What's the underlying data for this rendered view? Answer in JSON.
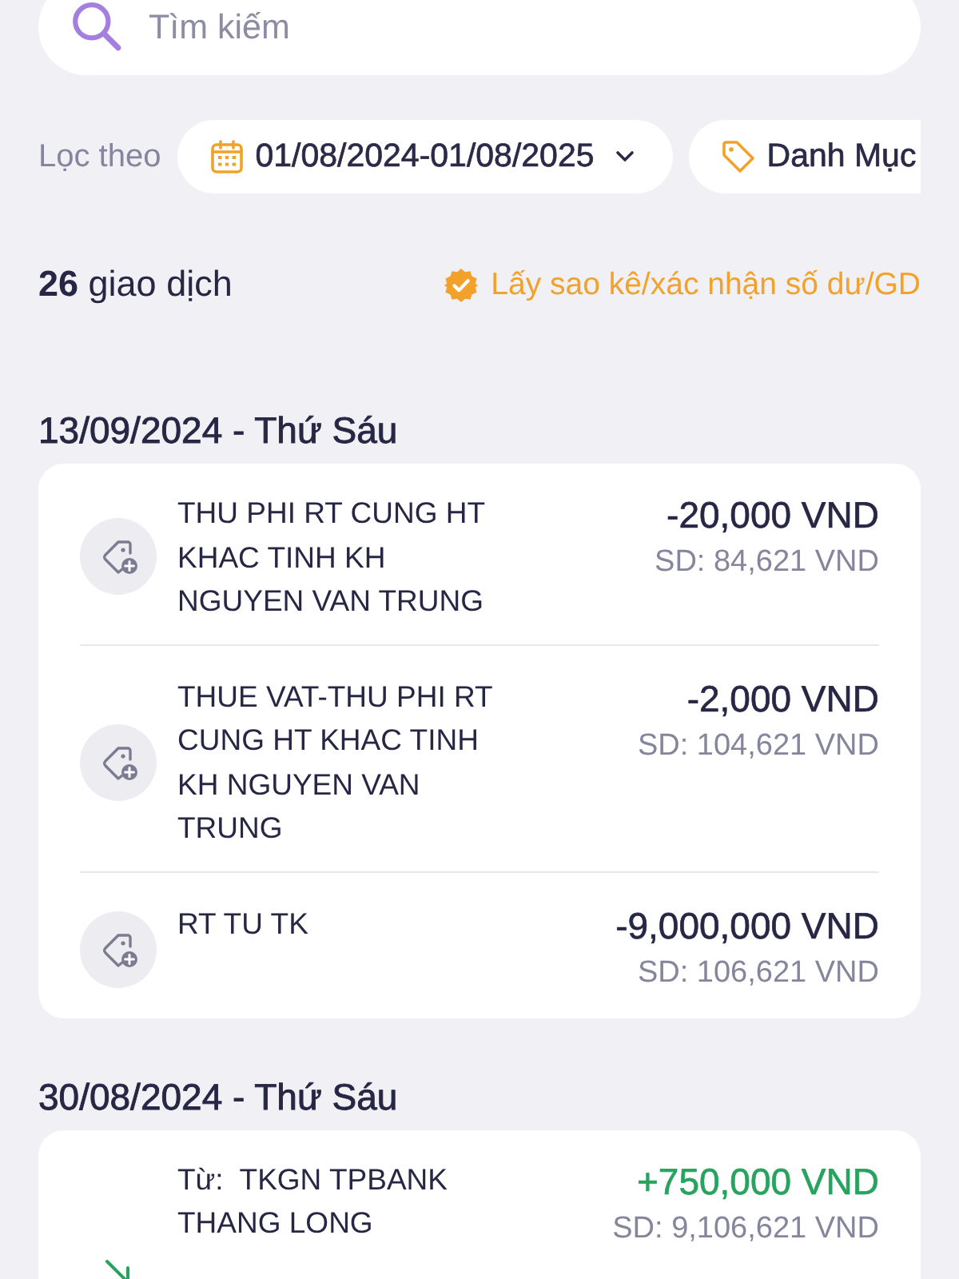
{
  "search": {
    "placeholder": "Tìm kiếm"
  },
  "filters": {
    "label": "Lọc theo",
    "chips": [
      {
        "kind": "date",
        "label": "01/08/2024-01/08/2025"
      },
      {
        "kind": "category",
        "label": "Danh Mục"
      }
    ]
  },
  "summary": {
    "count_text": "**26** giao dịch",
    "statement_link": "Lấy sao kê/xác nhận số dư/GD"
  },
  "groups": [
    {
      "date": "13/09/2024 - Thứ Sáu",
      "transactions": [
        {
          "kind": "debit",
          "description": "THU PHI RT CUNG HT KHAC TINH KH NGUYEN VAN TRUNG",
          "amount": "-20,000 VND",
          "balance": "SD: 84,621 VND"
        },
        {
          "kind": "debit",
          "description": "THUE VAT-THU PHI RT CUNG HT KHAC TINH KH NGUYEN VAN TRUNG",
          "amount": "-2,000 VND",
          "balance": "SD: 104,621 VND"
        },
        {
          "kind": "debit",
          "description": "RT TU TK",
          "amount": "-9,000,000 VND",
          "balance": "SD: 106,621 VND"
        }
      ]
    },
    {
      "date": "30/08/2024 - Thứ Sáu",
      "transactions": [
        {
          "kind": "credit",
          "description": "Từ:  TKGN TPBANK THANG LONG",
          "amount": "+750,000 VND",
          "balance": "SD: 9,106,621 VND"
        }
      ]
    }
  ]
}
